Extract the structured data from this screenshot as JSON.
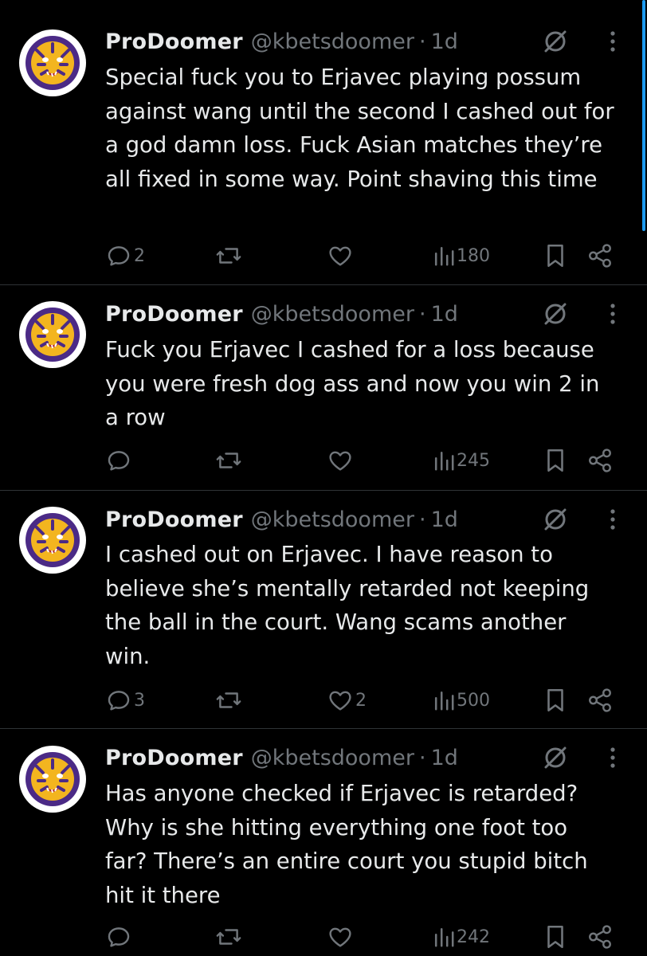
{
  "colors": {
    "background": "#000000",
    "text": "#e7e9ea",
    "muted": "#71767b",
    "divider": "#2f3336",
    "avatar_purple": "#4b2a86",
    "avatar_gold": "#f3b51f",
    "scroll_accent": "#1d9bf0"
  },
  "tweets": [
    {
      "name": "ProDoomer",
      "handle": "@kbetsdoomer",
      "dot": "·",
      "time": "1d",
      "text": "Special fuck you to Erjavec playing possum against wang until the second I cashed out for a god damn loss. Fuck Asian matches they’re all fixed in some way. Point shaving this time",
      "replies": "2",
      "reposts": "",
      "likes": "",
      "views": "180"
    },
    {
      "name": "ProDoomer",
      "handle": "@kbetsdoomer",
      "dot": "·",
      "time": "1d",
      "text": "Fuck you Erjavec I cashed for a loss because you were fresh dog ass and now you win 2 in a row",
      "replies": "",
      "reposts": "",
      "likes": "",
      "views": "245"
    },
    {
      "name": "ProDoomer",
      "handle": "@kbetsdoomer",
      "dot": "·",
      "time": "1d",
      "text": "I cashed out on Erjavec. I have reason to believe she’s mentally retarded not keeping the ball in the court. Wang scams another win.",
      "replies": "3",
      "reposts": "",
      "likes": "2",
      "views": "500"
    },
    {
      "name": "ProDoomer",
      "handle": "@kbetsdoomer",
      "dot": "·",
      "time": "1d",
      "text": "Has anyone checked if Erjavec is retarded? Why is she hitting everything one foot too far? There’s an entire court you stupid bitch hit it there",
      "replies": "",
      "reposts": "",
      "likes": "",
      "views": "242"
    }
  ]
}
